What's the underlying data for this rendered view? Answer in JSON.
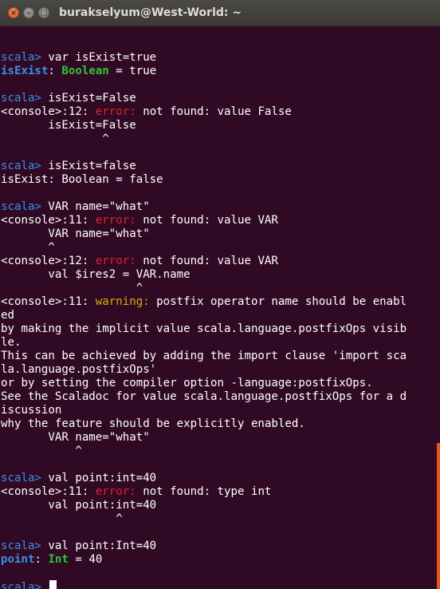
{
  "window": {
    "title": "burakselyum@West-World: ~",
    "buttons": {
      "close": "×",
      "minimize": "–",
      "maximize": "□"
    }
  },
  "terminal": {
    "prompt": "scala>",
    "lines": [
      {
        "segs": []
      },
      {
        "segs": [
          {
            "c": "prompt",
            "t": "scala>"
          },
          {
            "c": "",
            "t": " var isExist=true"
          }
        ]
      },
      {
        "segs": [
          {
            "c": "name",
            "t": "isExist"
          },
          {
            "c": "",
            "t": ": "
          },
          {
            "c": "type",
            "t": "Boolean"
          },
          {
            "c": "",
            "t": " = true"
          }
        ]
      },
      {
        "segs": []
      },
      {
        "segs": [
          {
            "c": "prompt",
            "t": "scala>"
          },
          {
            "c": "",
            "t": " isExist=False"
          }
        ]
      },
      {
        "segs": [
          {
            "c": "",
            "t": "<console>:12: "
          },
          {
            "c": "err",
            "t": "error:"
          },
          {
            "c": "",
            "t": " not found: value False"
          }
        ]
      },
      {
        "segs": [
          {
            "c": "",
            "t": "       isExist=False"
          }
        ]
      },
      {
        "segs": [
          {
            "c": "",
            "t": "               ^"
          }
        ]
      },
      {
        "segs": []
      },
      {
        "segs": [
          {
            "c": "prompt",
            "t": "scala>"
          },
          {
            "c": "",
            "t": " isExist=false"
          }
        ]
      },
      {
        "segs": [
          {
            "c": "",
            "t": "isExist: Boolean = false"
          }
        ]
      },
      {
        "segs": []
      },
      {
        "segs": [
          {
            "c": "prompt",
            "t": "scala>"
          },
          {
            "c": "",
            "t": " VAR name=\"what\""
          }
        ]
      },
      {
        "segs": [
          {
            "c": "",
            "t": "<console>:11: "
          },
          {
            "c": "err",
            "t": "error:"
          },
          {
            "c": "",
            "t": " not found: value VAR"
          }
        ]
      },
      {
        "segs": [
          {
            "c": "",
            "t": "       VAR name=\"what\""
          }
        ]
      },
      {
        "segs": [
          {
            "c": "",
            "t": "       ^"
          }
        ]
      },
      {
        "segs": [
          {
            "c": "",
            "t": "<console>:12: "
          },
          {
            "c": "err",
            "t": "error:"
          },
          {
            "c": "",
            "t": " not found: value VAR"
          }
        ]
      },
      {
        "segs": [
          {
            "c": "",
            "t": "       val $ires2 = VAR.name"
          }
        ]
      },
      {
        "segs": [
          {
            "c": "",
            "t": "                    ^"
          }
        ]
      },
      {
        "segs": [
          {
            "c": "",
            "t": "<console>:11: "
          },
          {
            "c": "warn",
            "t": "warning:"
          },
          {
            "c": "",
            "t": " postfix operator name should be enabl"
          }
        ]
      },
      {
        "segs": [
          {
            "c": "",
            "t": "ed"
          }
        ]
      },
      {
        "segs": [
          {
            "c": "",
            "t": "by making the implicit value scala.language.postfixOps visib"
          }
        ]
      },
      {
        "segs": [
          {
            "c": "",
            "t": "le."
          }
        ]
      },
      {
        "segs": [
          {
            "c": "",
            "t": "This can be achieved by adding the import clause 'import sca"
          }
        ]
      },
      {
        "segs": [
          {
            "c": "",
            "t": "la.language.postfixOps'"
          }
        ]
      },
      {
        "segs": [
          {
            "c": "",
            "t": "or by setting the compiler option -language:postfixOps."
          }
        ]
      },
      {
        "segs": [
          {
            "c": "",
            "t": "See the Scaladoc for value scala.language.postfixOps for a d"
          }
        ]
      },
      {
        "segs": [
          {
            "c": "",
            "t": "iscussion"
          }
        ]
      },
      {
        "segs": [
          {
            "c": "",
            "t": "why the feature should be explicitly enabled."
          }
        ]
      },
      {
        "segs": [
          {
            "c": "",
            "t": "       VAR name=\"what\""
          }
        ]
      },
      {
        "segs": [
          {
            "c": "",
            "t": "           ^"
          }
        ]
      },
      {
        "segs": []
      },
      {
        "segs": [
          {
            "c": "prompt",
            "t": "scala>"
          },
          {
            "c": "",
            "t": " val point:int=40"
          }
        ]
      },
      {
        "segs": [
          {
            "c": "",
            "t": "<console>:11: "
          },
          {
            "c": "err",
            "t": "error:"
          },
          {
            "c": "",
            "t": " not found: type int"
          }
        ]
      },
      {
        "segs": [
          {
            "c": "",
            "t": "       val point:int=40"
          }
        ]
      },
      {
        "segs": [
          {
            "c": "",
            "t": "                 ^"
          }
        ]
      },
      {
        "segs": []
      },
      {
        "segs": [
          {
            "c": "prompt",
            "t": "scala>"
          },
          {
            "c": "",
            "t": " val point:Int=40"
          }
        ]
      },
      {
        "segs": [
          {
            "c": "name",
            "t": "point"
          },
          {
            "c": "",
            "t": ": "
          },
          {
            "c": "type",
            "t": "Int"
          },
          {
            "c": "",
            "t": " = 40"
          }
        ]
      },
      {
        "segs": []
      },
      {
        "segs": [
          {
            "c": "prompt",
            "t": "scala>"
          },
          {
            "c": "",
            "t": " "
          }
        ],
        "cursor": true
      }
    ]
  },
  "colors": {
    "background": "#300a24",
    "prompt": "#3b8eea",
    "error": "#e02424",
    "warning": "#d4b100",
    "type": "#2fc434",
    "scrollbar": "#e2571e"
  }
}
